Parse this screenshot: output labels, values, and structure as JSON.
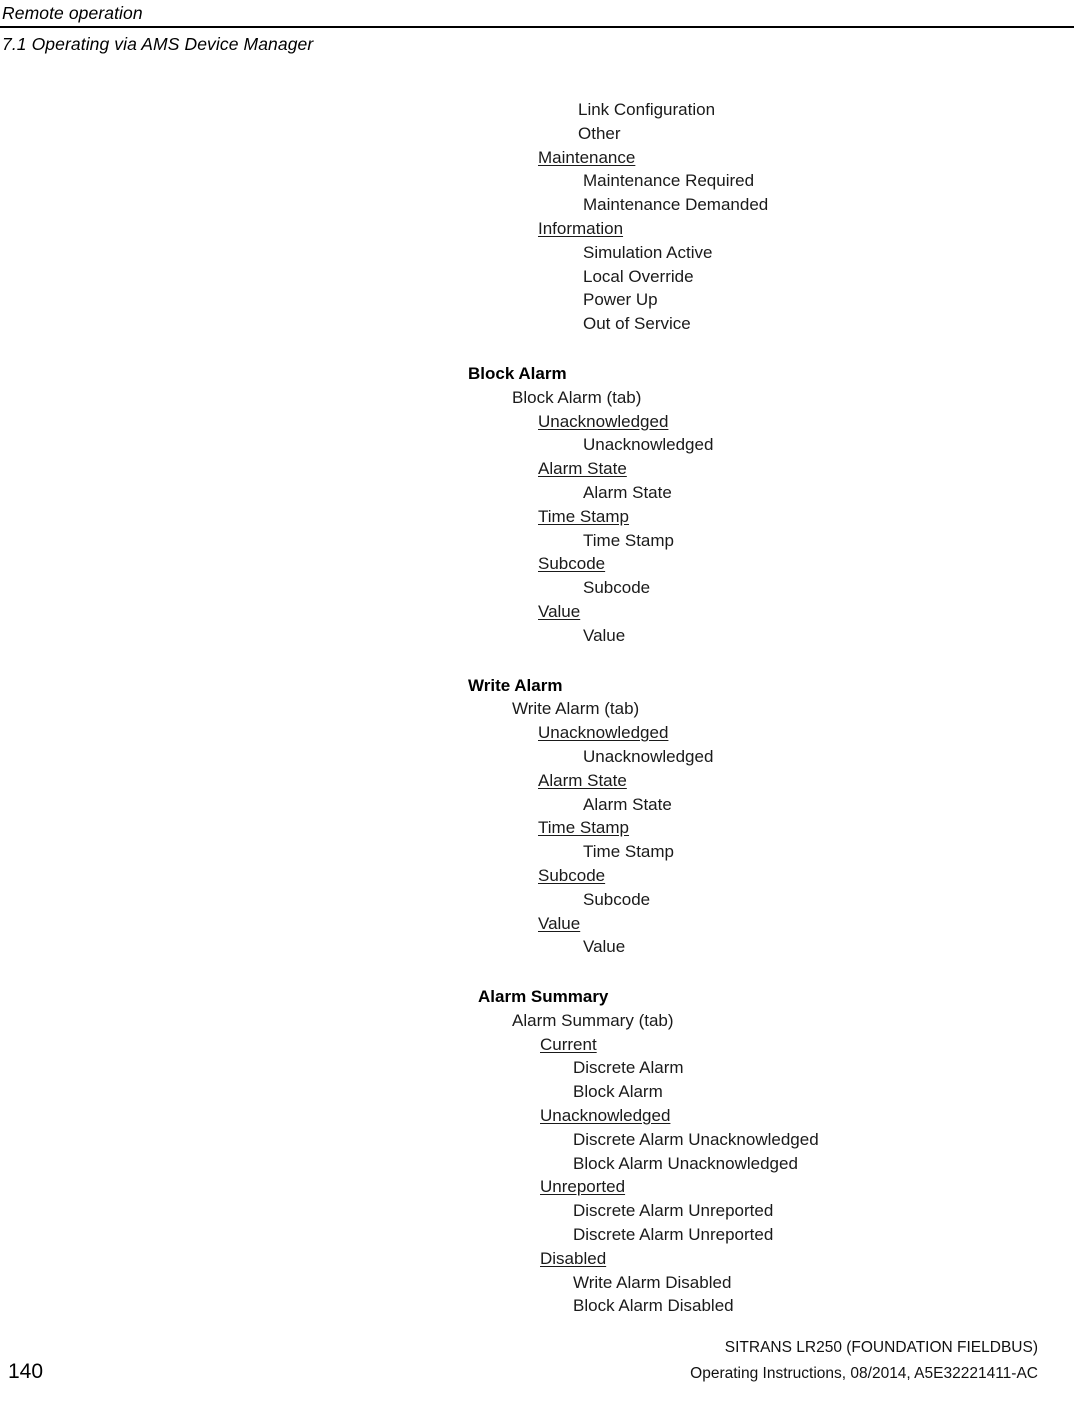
{
  "header": {
    "title": "Remote operation",
    "subtitle": "7.1 Operating via AMS Device Manager"
  },
  "outline": {
    "continued_block": {
      "items": [
        {
          "label": "Link Configuration",
          "level": "item"
        },
        {
          "label": "Other",
          "level": "item"
        },
        {
          "label": "Maintenance",
          "level": "group",
          "underlined": true
        },
        {
          "label": "Maintenance Required",
          "level": "itemA"
        },
        {
          "label": "Maintenance Demanded",
          "level": "itemA"
        },
        {
          "label": "Information",
          "level": "group",
          "underlined": true
        },
        {
          "label": "Simulation Active",
          "level": "itemA"
        },
        {
          "label": "Local Override",
          "level": "itemA"
        },
        {
          "label": "Power Up",
          "level": "itemA"
        },
        {
          "label": "Out of Service",
          "level": "itemA"
        }
      ]
    },
    "sections": [
      {
        "heading": "Block Alarm",
        "tab": "Block Alarm (tab)",
        "groups": [
          {
            "label": "Unacknowledged",
            "items": [
              "Unacknowledged"
            ]
          },
          {
            "label": "Alarm State",
            "items": [
              "Alarm State"
            ]
          },
          {
            "label": "Time Stamp",
            "items": [
              "Time Stamp"
            ]
          },
          {
            "label": "Subcode",
            "items": [
              "Subcode"
            ]
          },
          {
            "label": "Value",
            "items": [
              "Value"
            ]
          }
        ]
      },
      {
        "heading": "Write Alarm",
        "tab": "Write Alarm (tab)",
        "groups": [
          {
            "label": "Unacknowledged",
            "items": [
              "Unacknowledged"
            ]
          },
          {
            "label": "Alarm State",
            "items": [
              "Alarm State"
            ]
          },
          {
            "label": "Time Stamp",
            "items": [
              "Time Stamp"
            ]
          },
          {
            "label": "Subcode",
            "items": [
              "Subcode"
            ]
          },
          {
            "label": "Value",
            "items": [
              "Value"
            ]
          }
        ]
      },
      {
        "heading": "Alarm Summary",
        "tab": "Alarm Summary (tab)",
        "wide": true,
        "groups": [
          {
            "label": "Current",
            "items": [
              "Discrete Alarm",
              "Block Alarm"
            ]
          },
          {
            "label": "Unacknowledged",
            "items": [
              "Discrete Alarm Unacknowledged",
              "Block Alarm Unacknowledged"
            ]
          },
          {
            "label": "Unreported",
            "items": [
              "Discrete Alarm Unreported",
              "Discrete Alarm Unreported"
            ]
          },
          {
            "label": "Disabled",
            "items": [
              "Write Alarm Disabled",
              "Block Alarm Disabled"
            ]
          }
        ]
      }
    ]
  },
  "footer": {
    "page_number": "140",
    "product_line": "SITRANS LR250 (FOUNDATION FIELDBUS)",
    "document_line": "Operating Instructions, 08/2014, A5E32221411-AC"
  }
}
